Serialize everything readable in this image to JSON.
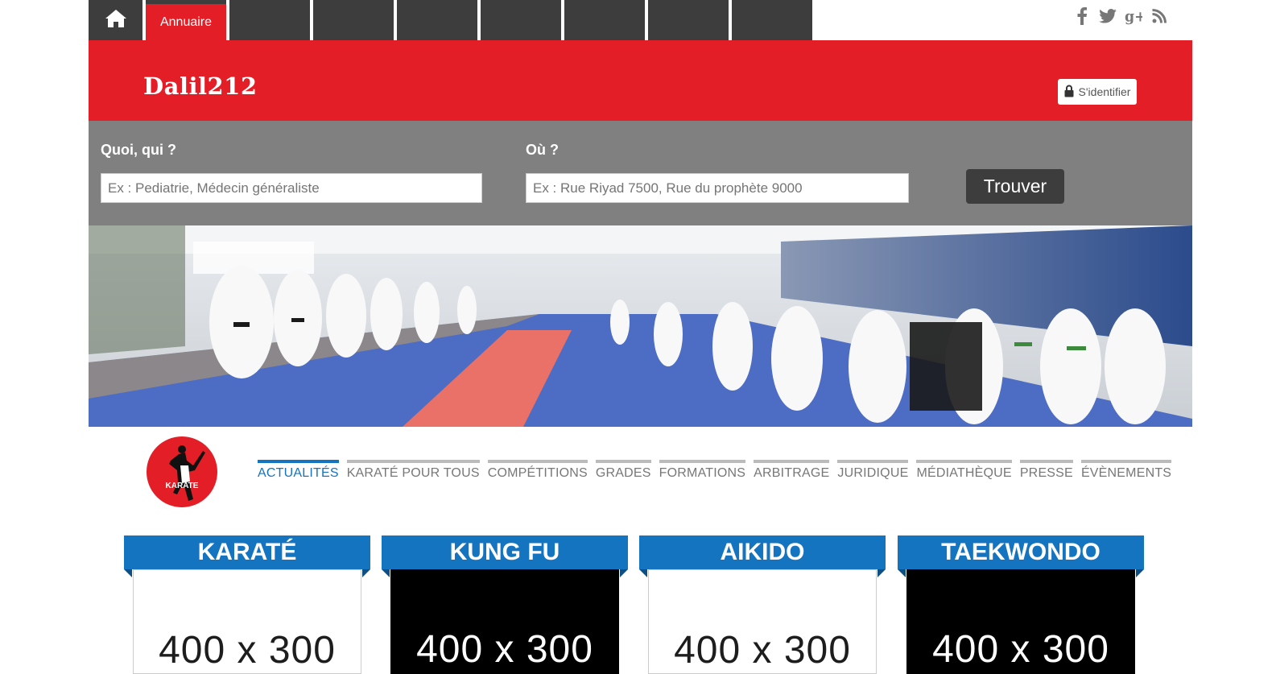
{
  "topnav": {
    "home_icon": "home-icon",
    "active_tab": "Annuaire",
    "empty_tabs": 8,
    "social_icons": [
      "facebook-icon",
      "twitter-icon",
      "google-plus-icon",
      "rss-icon"
    ]
  },
  "header": {
    "logo": "Dalil212",
    "login_label": "S'identifier",
    "lock_icon": "lock-icon",
    "brand_color": "#e41e26"
  },
  "search": {
    "what_label": "Quoi, qui ?",
    "what_placeholder": "Ex : Pediatrie, Médecin généraliste",
    "where_label": "Où ?",
    "where_placeholder": "Ex : Rue Riyad 7500, Rue du prophète 9000",
    "submit_label": "Trouver"
  },
  "badge": {
    "text": "KARATE"
  },
  "subnav": {
    "accent": "#1474bf",
    "items": [
      "ACTUALITÉS",
      "KARATÉ POUR TOUS",
      "COMPÉTITIONS",
      "GRADES",
      "FORMATIONS",
      "ARBITRAGE",
      "JURIDIQUE",
      "MÉDIATHÈQUE",
      "PRESSE",
      "ÉVÈNEMENTS"
    ]
  },
  "cards": [
    {
      "title": "KARATÉ",
      "placeholder": "400 x 300",
      "theme": "white"
    },
    {
      "title": "KUNG FU",
      "placeholder": "400 x 300",
      "theme": "black"
    },
    {
      "title": "AIKIDO",
      "placeholder": "400 x 300",
      "theme": "white"
    },
    {
      "title": "TAEKWONDO",
      "placeholder": "400 x 300",
      "theme": "black"
    }
  ]
}
